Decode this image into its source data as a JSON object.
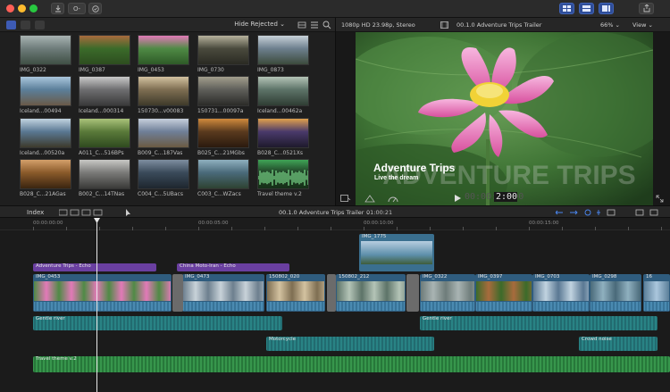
{
  "titlebar": {
    "key_label": "O‑",
    "colors": {
      "close": "#ff5f57",
      "minimize": "#febc2e",
      "zoom": "#28c840"
    }
  },
  "browser": {
    "filter_label": "Hide Rejected ⌄",
    "clips": [
      {
        "label": "IMG_0322",
        "colors": [
          "#6e7c7a",
          "#a9b4b3",
          "#3f4f44"
        ]
      },
      {
        "label": "IMG_0387",
        "colors": [
          "#3b6b2a",
          "#a86b3d",
          "#2d4d1f"
        ]
      },
      {
        "label": "IMG_0453",
        "colors": [
          "#4f8a45",
          "#e27ab8",
          "#2e5a27"
        ]
      },
      {
        "label": "IMG_0730",
        "colors": [
          "#4a4a3d",
          "#b6b29c",
          "#2a2a23"
        ]
      },
      {
        "label": "IMG_0873",
        "colors": [
          "#6d7f8e",
          "#c8d2d9",
          "#3c4a3c"
        ]
      },
      {
        "label": "Iceland...00494",
        "colors": [
          "#5b7f9a",
          "#aac6dc",
          "#6a5a48"
        ]
      },
      {
        "label": "Iceland...000314",
        "colors": [
          "#6e6e70",
          "#c9c9c9",
          "#3a3a3a"
        ]
      },
      {
        "label": "150730...v00083",
        "colors": [
          "#7e6e52",
          "#d3c2a0",
          "#3e3a2a"
        ]
      },
      {
        "label": "150731...00097a",
        "colors": [
          "#5f5f5a",
          "#a39f8d",
          "#2b2b28"
        ]
      },
      {
        "label": "Iceland...00462a",
        "colors": [
          "#5d7368",
          "#b4c4b7",
          "#2f3d33"
        ]
      },
      {
        "label": "Iceland...00520a",
        "colors": [
          "#5a7893",
          "#c1d3e0",
          "#3d3a2c"
        ]
      },
      {
        "label": "A011_C...516BPs",
        "colors": [
          "#5a7a3a",
          "#aac37a",
          "#2f4a1f"
        ]
      },
      {
        "label": "B009_C...187Vas",
        "colors": [
          "#6f7f98",
          "#c6cfdc",
          "#6b5b43"
        ]
      },
      {
        "label": "B025_C...21MGbs",
        "colors": [
          "#5a3a1e",
          "#d08a3c",
          "#2a1a0e"
        ]
      },
      {
        "label": "B028_C...0521Xs",
        "colors": [
          "#4a3a6b",
          "#e0a04c",
          "#1e1a2c"
        ]
      },
      {
        "label": "B028_C...21AGas",
        "colors": [
          "#8a5a2a",
          "#d4a06a",
          "#3a2410"
        ]
      },
      {
        "label": "B002_C...14TNas",
        "colors": [
          "#7a7a78",
          "#c8c8c5",
          "#3a3a38"
        ]
      },
      {
        "label": "C004_C...5UBacs",
        "colors": [
          "#3a4a5a",
          "#7e8ea0",
          "#1e262e"
        ]
      },
      {
        "label": "C003_C...WZacs",
        "colors": [
          "#4a6a7a",
          "#8fb0bf",
          "#2e4232"
        ]
      },
      {
        "label": "Travel theme v.2",
        "colors": [
          "#1f3f25",
          "#3fa456",
          "#163018"
        ]
      }
    ]
  },
  "viewer": {
    "format": "1080p HD 23.98p, Stereo",
    "project": "00.1.0 Adventure Trips Trailer",
    "zoom": "66% ⌄",
    "view": "View ⌄",
    "title": "Adventure Trips",
    "subtitle": "Live the dream",
    "background_title": "ADVENTURE TRIPS",
    "timecode": "00:00:02:00",
    "timecode_bright": "2:00"
  },
  "timeline": {
    "index_label": "Index",
    "project_label": "00.1.0 Adventure Trips Trailer ⌄",
    "duration": "01:00:21",
    "ruler": [
      "00:00:00:00",
      "00:00:05:00",
      "00:00:10:00",
      "00:00:15:00",
      "00:00:20:00",
      "00:00:25:00",
      "00:00:30:00",
      "00:00:35:00",
      "00:00:40:00"
    ],
    "connected": [
      {
        "label": "IMG_1775"
      }
    ],
    "titles": [
      {
        "label": "Adventure Trips - Echo"
      },
      {
        "label": "China Moto-Iran - Echo"
      }
    ],
    "primary": [
      {
        "label": "IMG_0453"
      },
      {
        "label": "IMG_0473"
      },
      {
        "label": "150802_020"
      },
      {
        "label": "150802_212"
      },
      {
        "label": "IMG_0322"
      },
      {
        "label": "IMG_0397"
      },
      {
        "label": "IMG_0703"
      },
      {
        "label": "IMG_0298"
      },
      {
        "label": "16"
      }
    ],
    "audio": [
      {
        "label": "Gentle river"
      },
      {
        "label": "Gentle river"
      },
      {
        "label": "Motorcycle"
      },
      {
        "label": "Crowd noise"
      }
    ],
    "music": {
      "label": "Travel theme v.2"
    }
  }
}
